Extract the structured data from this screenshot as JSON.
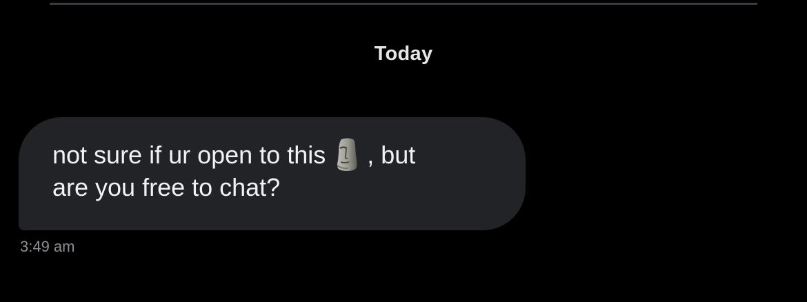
{
  "conversation": {
    "date_separator": "Today",
    "messages": [
      {
        "text_before_emoji": "not sure if ur open to this",
        "emoji": "moai-icon",
        "text_after_emoji": ", but",
        "line2": "are you free to chat?",
        "time": "3:49 am"
      }
    ]
  },
  "colors": {
    "background": "#000000",
    "bubble": "#222326",
    "text": "#f2f2f4",
    "timestamp": "#8d8e93"
  }
}
